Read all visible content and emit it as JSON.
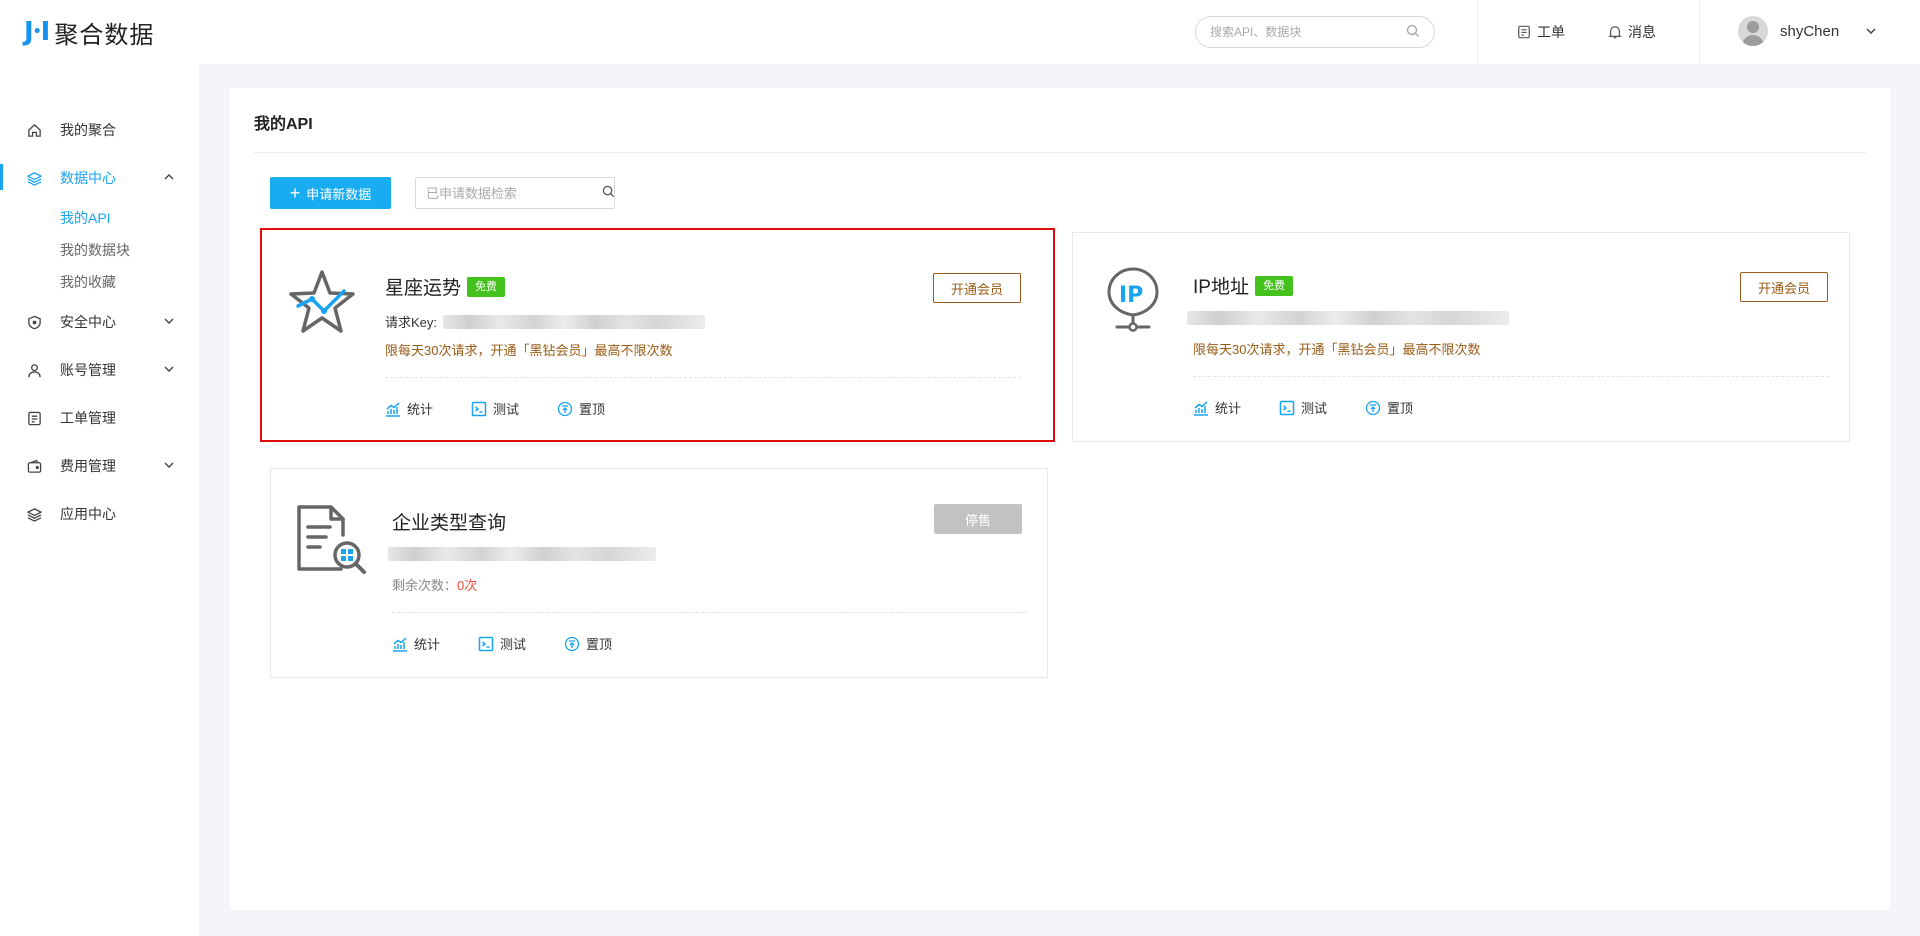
{
  "brand": {
    "mark": "J·I",
    "name": "聚合数据"
  },
  "sidebar": {
    "items": [
      {
        "label": "我的聚合",
        "icon": "home-icon"
      },
      {
        "label": "数据中心",
        "icon": "layers-icon",
        "expanded": true,
        "children": [
          {
            "label": "我的API",
            "active": true
          },
          {
            "label": "我的数据块"
          },
          {
            "label": "我的收藏"
          }
        ]
      },
      {
        "label": "安全中心",
        "icon": "shield-icon"
      },
      {
        "label": "账号管理",
        "icon": "user-icon"
      },
      {
        "label": "工单管理",
        "icon": "ticket-icon"
      },
      {
        "label": "费用管理",
        "icon": "wallet-icon"
      },
      {
        "label": "应用中心",
        "icon": "layers-icon"
      }
    ]
  },
  "header": {
    "search_placeholder": "搜索API、数据块",
    "ticket_label": "工单",
    "message_label": "消息",
    "user_name": "shyChen"
  },
  "main": {
    "title": "我的API",
    "apply_button": "申请新数据",
    "filter_placeholder": "已申请数据检索",
    "cards": [
      {
        "name": "星座运势",
        "badge": "免费",
        "key_label": "请求Key:",
        "limit_text": "限每天30次请求，开通「黑钻会员」最高不限次数",
        "button": "开通会员",
        "icon": "star-chart-icon"
      },
      {
        "name": "IP地址",
        "badge": "免费",
        "limit_text": "限每天30次请求，开通「黑钻会员」最高不限次数",
        "button": "开通会员",
        "icon": "ip-location-icon"
      },
      {
        "name": "企业类型查询",
        "remain_label": "剩余次数：",
        "remain_count": "0次",
        "button": "停售",
        "icon": "document-search-icon"
      }
    ],
    "actions": {
      "stats": "统计",
      "test": "测试",
      "pin": "置顶"
    }
  },
  "colors": {
    "accent": "#1aa3f0",
    "primary_button": "#1aacf0",
    "free_badge": "#43c11c",
    "vip": "#9a5b16",
    "highlight_border": "#e00c0c",
    "remaining_zero": "#f04a3a"
  }
}
